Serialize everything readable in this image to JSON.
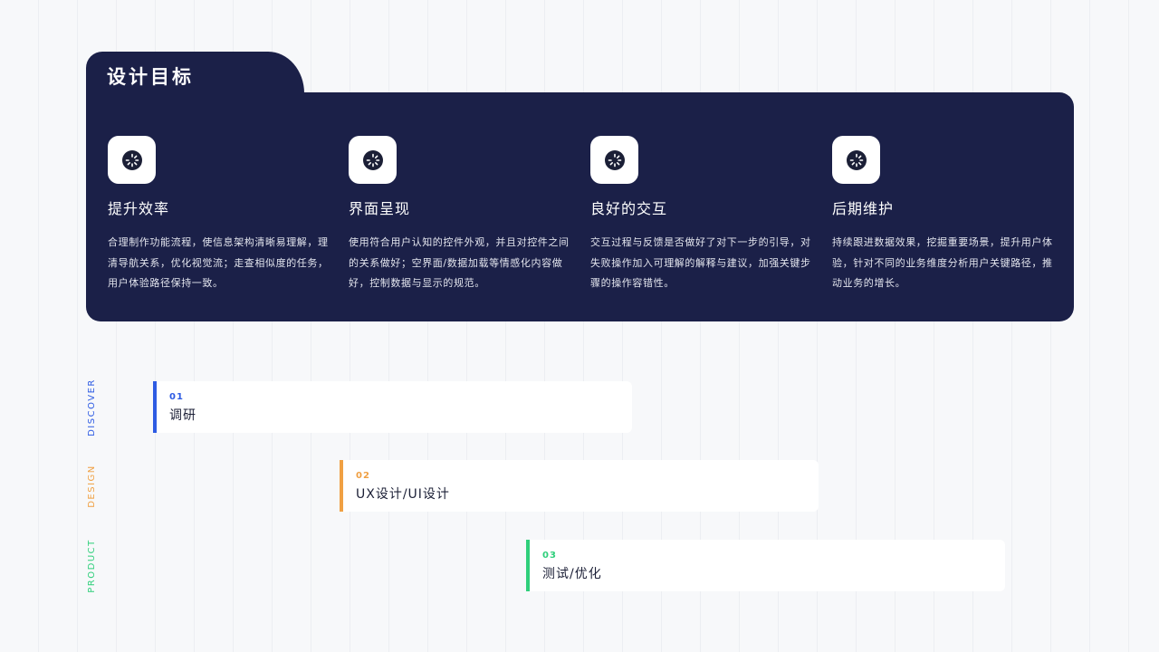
{
  "goals": {
    "title": "设计目标",
    "items": [
      {
        "icon": "loading-spinner-icon",
        "title": "提升效率",
        "desc": "合理制作功能流程，使信息架构清晰易理解，理清导航关系，优化视觉流；走查相似度的任务，用户体验路径保持一致。"
      },
      {
        "icon": "loading-spinner-icon",
        "title": "界面呈现",
        "desc": "使用符合用户认知的控件外观，并且对控件之间的关系做好；空界面/数据加载等情感化内容做好，控制数据与显示的规范。"
      },
      {
        "icon": "loading-spinner-icon",
        "title": "良好的交互",
        "desc": "交互过程与反馈是否做好了对下一步的引导，对失败操作加入可理解的解释与建议，加强关键步骤的操作容错性。"
      },
      {
        "icon": "loading-spinner-icon",
        "title": "后期维护",
        "desc": "持续跟进数据效果，挖掘重要场景，提升用户体验，针对不同的业务维度分析用户关键路径，推动业务的增长。"
      }
    ]
  },
  "timeline": {
    "phases": [
      {
        "label": "DISCOVER",
        "color": "#2d5be3",
        "num": "01",
        "name": "调研"
      },
      {
        "label": "DESIGN",
        "color": "#f0a043",
        "num": "02",
        "name": "UX设计/UI设计"
      },
      {
        "label": "PRODUCT",
        "color": "#2fcf7b",
        "num": "03",
        "name": "测试/优化"
      }
    ]
  }
}
